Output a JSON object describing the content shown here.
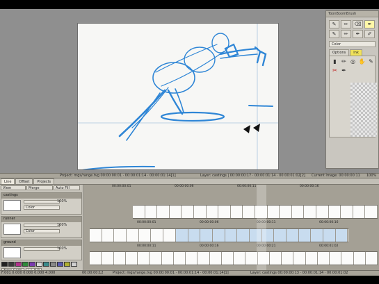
{
  "tool_panel": {
    "title": "ToonBoomBrush",
    "tools": [
      "brush-icon",
      "pencil-icon",
      "eraser-icon",
      "paint-icon",
      "brush-icon",
      "pencil-icon",
      "ink-icon",
      "stroke-icon"
    ],
    "color_label": "Color",
    "tabs": [
      "Options",
      "Ink"
    ],
    "active_tab": "Ink",
    "brushes": [
      "brush-icon",
      "pencil-icon",
      "lasso-icon",
      "hand-icon",
      "pencil-icon",
      "eraser-icon",
      "pen-icon"
    ]
  },
  "info_bar": {
    "project": "Project: mgs/range.tvg 00:00:00:01 · 00:00:01:14 · 00:00:01:14[1]",
    "layer": "Layer: castings | 00:00:00:17 · 00:00:01:14 · 00:00:01:02[2]",
    "current_image": "Current Image: 00:00:00:11",
    "zoom": "100%"
  },
  "timeline_tabs": [
    {
      "label": "Line",
      "active": true
    },
    {
      "label": "Offset",
      "active": false
    },
    {
      "label": "Projects",
      "active": false
    }
  ],
  "layer_panel": {
    "view_label": "View",
    "merge_label": "Merge",
    "autofill_label": "Auto Fill",
    "layers": [
      {
        "name": "castings",
        "opacity": "100%",
        "mode": "Color"
      },
      {
        "name": "runner",
        "opacity": "100%",
        "mode": "Color"
      },
      {
        "name": "ground",
        "opacity": "100%",
        "mode": "Color"
      }
    ],
    "swatch_colors": [
      "#222222",
      "#3a3a3a",
      "#b0308a",
      "#2e8a3a",
      "#7a3ab0",
      "#d8d8d8",
      "#3a8a8a",
      "#888888",
      "#5a5ab0",
      "#b0b030",
      "#d0d0d0"
    ],
    "bottom_buttons": [
      "Time Code",
      "+/- 0 0"
    ]
  },
  "rulers": {
    "top": [
      "00:00:00:01",
      "00:00:00:06",
      "00:00:00:11",
      "00:00:00:16"
    ],
    "castings": [
      "00:00:00:01",
      "00:00:00:06",
      "00:00:00:11",
      "00:00:00:16"
    ],
    "runner": [
      "00:00:00:11",
      "00:00:00:16",
      "00:00:00:21",
      "00:00:01:02"
    ]
  },
  "timeline_status": {
    "left": "F:001   0.000  0.000 0.000  4.000",
    "middle": "00:00:00:12",
    "project": "Project: mgs/range.tvg   00:00:00:01 · 00:00:01:14 · 00:00:01:14[1]",
    "layer": "Layer: castings   00:00:00:13 · 00:00:01:14 · 00:00:01:02"
  },
  "accent_colors": {
    "ink": "#2f86d6",
    "active_tab": "#f0e25a"
  }
}
